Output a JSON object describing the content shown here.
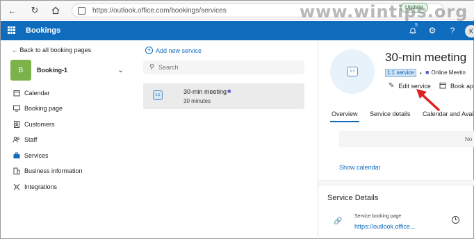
{
  "browser": {
    "url": "https://outlook.office.com/bookings/services",
    "update_label": "Update",
    "watermark": "www.wintips.org"
  },
  "header": {
    "app_title": "Bookings",
    "notification_count": "5",
    "help_icon": "?",
    "avatar_initial": "K"
  },
  "sidebar": {
    "back_label": "Back to all booking pages",
    "booking_initial": "B",
    "booking_name": "Booking-1",
    "items": [
      {
        "label": "Calendar",
        "icon": "calendar-icon"
      },
      {
        "label": "Booking page",
        "icon": "monitor-icon"
      },
      {
        "label": "Customers",
        "icon": "contact-card-icon"
      },
      {
        "label": "Staff",
        "icon": "people-icon"
      },
      {
        "label": "Services",
        "icon": "briefcase-icon",
        "active": true
      },
      {
        "label": "Business information",
        "icon": "building-icon"
      },
      {
        "label": "Integrations",
        "icon": "integrations-icon"
      }
    ]
  },
  "services_list": {
    "add_label": "Add new service",
    "search_placeholder": "Search",
    "items": [
      {
        "name": "30-min meeting",
        "duration": "30 minutes",
        "thumb": "1:1"
      }
    ]
  },
  "detail": {
    "title": "30-min meeting",
    "thumb": "1:1",
    "tag": "1:1 service",
    "separator": "•",
    "online_label": "Online Meetin",
    "edit_label": "Edit service",
    "book_label": "Book ap",
    "tabs": [
      "Overview",
      "Service details",
      "Calendar and Avail"
    ],
    "active_tab": "Overview",
    "calendar_placeholder": "No",
    "show_calendar": "Show calendar",
    "section_title": "Service Details",
    "booking_page_label": "Service booking page",
    "booking_page_url": "https://outlook.office..."
  },
  "colors": {
    "brand": "#0f6cbd",
    "annotation_arrow": "#e02020"
  }
}
